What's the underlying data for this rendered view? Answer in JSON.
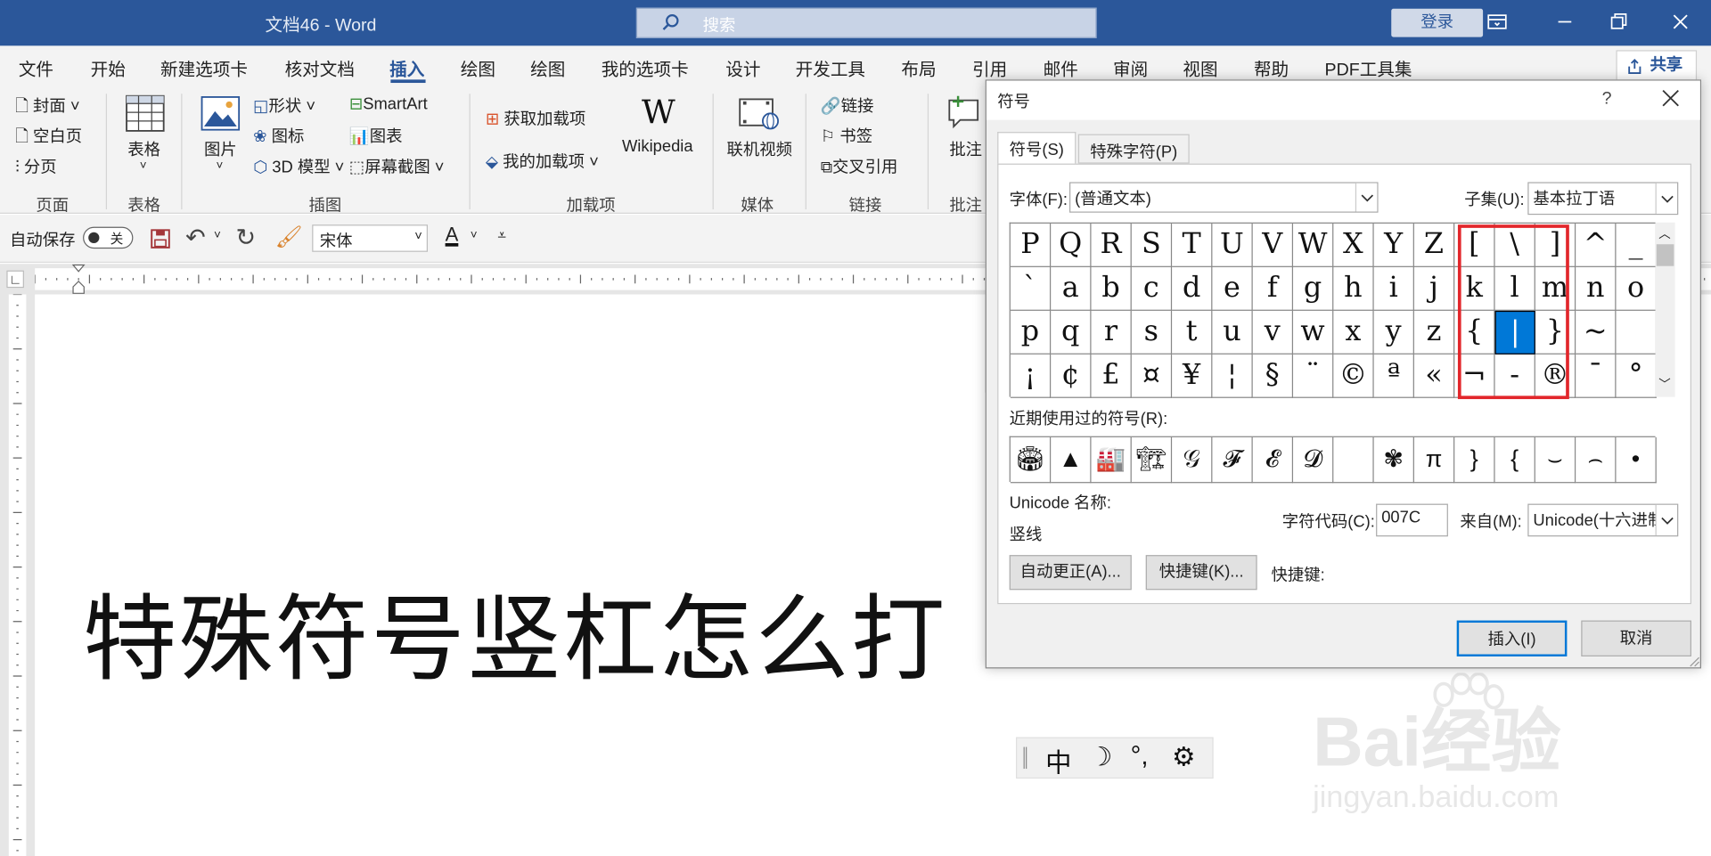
{
  "window": {
    "title": "文档46 - Word",
    "search_placeholder": "搜索",
    "login": "登录"
  },
  "tabs": [
    "文件",
    "开始",
    "新建选项卡",
    "核对文档",
    "插入",
    "绘图",
    "绘图",
    "我的选项卡",
    "设计",
    "开发工具",
    "布局",
    "引用",
    "邮件",
    "审阅",
    "视图",
    "帮助",
    "PDF工具集"
  ],
  "active_tab": "插入",
  "share": "共享",
  "ribbon": {
    "pages": {
      "cover": "封面",
      "blank": "空白页",
      "break": "分页",
      "group": "页面"
    },
    "tables": {
      "table": "表格",
      "group": "表格"
    },
    "illustrations": {
      "pictures": "图片",
      "shapes": "形状",
      "icons": "图标",
      "model3d": "3D 模型",
      "smartart": "SmartArt",
      "chart": "图表",
      "screenshot": "屏幕截图",
      "group": "插图"
    },
    "addins": {
      "get": "获取加载项",
      "mine": "我的加载项",
      "wikipedia": "Wikipedia",
      "group": "加载项"
    },
    "media": {
      "video": "联机视频",
      "group": "媒体"
    },
    "links": {
      "link": "链接",
      "bookmark": "书签",
      "crossref": "交叉引用",
      "group": "链接"
    },
    "comments": {
      "comment": "批注",
      "group": "批注"
    }
  },
  "qat": {
    "autosave": "自动保存",
    "autosave_state": "关",
    "font": "宋体",
    "font_color_letter": "A"
  },
  "document": {
    "text": "特殊符号竖杠怎么打"
  },
  "ime": {
    "mode": "中",
    "moon": "☽",
    "punct": "°,",
    "gear": "⚙"
  },
  "dialog": {
    "title": "符号",
    "help": "?",
    "tab_symbols": "符号(S)",
    "tab_special": "特殊字符(P)",
    "font_label": "字体(F):",
    "font_value": "(普通文本)",
    "subset_label": "子集(U):",
    "subset_value": "基本拉丁语",
    "grid": [
      [
        "P",
        "Q",
        "R",
        "S",
        "T",
        "U",
        "V",
        "W",
        "X",
        "Y",
        "Z",
        "[",
        "\\",
        "]",
        "^",
        "_"
      ],
      [
        "`",
        "a",
        "b",
        "c",
        "d",
        "e",
        "f",
        "g",
        "h",
        "i",
        "j",
        "k",
        "l",
        "m",
        "n",
        "o"
      ],
      [
        "p",
        "q",
        "r",
        "s",
        "t",
        "u",
        "v",
        "w",
        "x",
        "y",
        "z",
        "{",
        "|",
        "}",
        "~",
        ""
      ],
      [
        "¡",
        "¢",
        "£",
        "¤",
        "¥",
        "¦",
        "§",
        "¨",
        "©",
        "ª",
        "«",
        "¬",
        "-",
        "®",
        "¯",
        "°"
      ]
    ],
    "recent_label": "近期使用过的符号(R):",
    "recent": [
      "🏟",
      "▲",
      "🏭",
      "🏗",
      "𝒢",
      "𝓕",
      "𝓔",
      "𝓓",
      "",
      "✾",
      "π",
      "}",
      "{",
      "⌣",
      "⌢",
      "•"
    ],
    "unicode_name_label": "Unicode 名称:",
    "unicode_name": "竖线",
    "code_label": "字符代码(C):",
    "code_value": "007C",
    "from_label": "来自(M):",
    "from_value": "Unicode(十六进制)",
    "autocorrect": "自动更正(A)...",
    "shortcut_btn": "快捷键(K)...",
    "shortcut_label": "快捷键:",
    "insert": "插入(I)",
    "cancel": "取消"
  },
  "watermark": {
    "brand": "Bai经验",
    "url": "jingyan.baidu.com"
  },
  "colors": {
    "accent": "#2b579a",
    "selection": "#0078d7",
    "highlight": "#e2262b"
  }
}
